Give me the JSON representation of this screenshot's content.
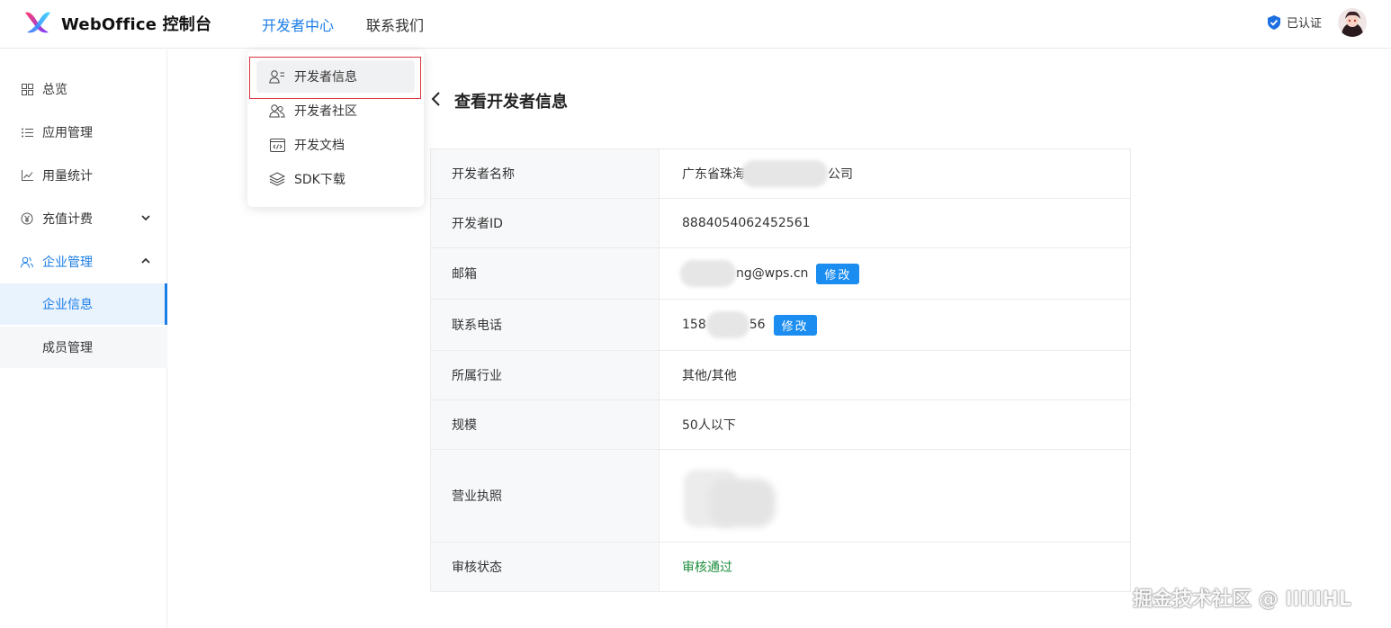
{
  "header": {
    "brand": "WebOffice 控制台",
    "nav": [
      "开发者中心",
      "联系我们"
    ],
    "verified_label": "已认证"
  },
  "dropdown": {
    "items": [
      "开发者信息",
      "开发者社区",
      "开发文档",
      "SDK下载"
    ]
  },
  "sidebar": {
    "items": [
      "总览",
      "应用管理",
      "用量统计",
      "充值计费",
      "企业管理"
    ],
    "sub_items": [
      "企业信息",
      "成员管理"
    ]
  },
  "main": {
    "title": "查看开发者信息",
    "rows": [
      {
        "label": "开发者名称",
        "value_prefix": "广东省珠海",
        "value_suffix": "公司"
      },
      {
        "label": "开发者ID",
        "value": "8884054062452561"
      },
      {
        "label": "邮箱",
        "value_suffix": "ng@wps.cn",
        "action": "修改"
      },
      {
        "label": "联系电话",
        "value_prefix": "158",
        "value_suffix": "56",
        "action": "修改"
      },
      {
        "label": "所属行业",
        "value": "其他/其他"
      },
      {
        "label": "规模",
        "value": "50人以下"
      },
      {
        "label": "营业执照"
      },
      {
        "label": "审核状态",
        "value": "审核通过"
      }
    ]
  },
  "watermark": "掘金技术社区 @ IIIIIHL",
  "colors": {
    "accent": "#1b7de6",
    "button": "#1b8df0",
    "status_ok": "#1e8e3e",
    "highlight": "#d9363e"
  }
}
